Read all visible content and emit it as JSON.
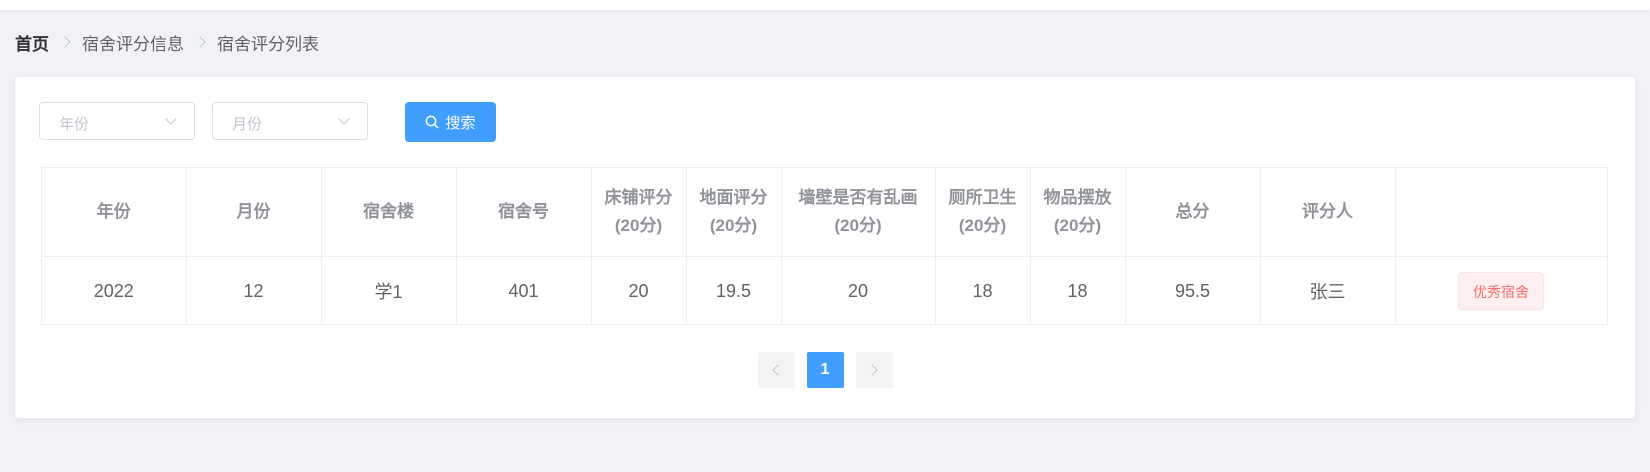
{
  "breadcrumb": {
    "home": "首页",
    "level1": "宿舍评分信息",
    "level2": "宿舍评分列表"
  },
  "filters": {
    "year_placeholder": "年份",
    "month_placeholder": "月份",
    "search_label": "搜索"
  },
  "table": {
    "headers": [
      "年份",
      "月份",
      "宿舍楼",
      "宿舍号",
      "床铺评分\n(20分)",
      "地面评分\n(20分)",
      "墙壁是否有乱画\n(20分)",
      "厕所卫生\n(20分)",
      "物品摆放\n(20分)",
      "总分",
      "评分人",
      ""
    ],
    "rows": [
      {
        "year": "2022",
        "month": "12",
        "building": "学1",
        "room": "401",
        "bed_score": "20",
        "floor_score": "19.5",
        "wall_score": "20",
        "toilet_score": "18",
        "items_score": "18",
        "total": "95.5",
        "rater": "张三",
        "tag": "优秀宿舍"
      }
    ]
  },
  "pagination": {
    "current_page": "1"
  },
  "colors": {
    "primary": "#409eff",
    "tag_danger_text": "#f56c6c",
    "tag_danger_bg": "#fef0f0",
    "page_bg": "#f0f2f5"
  },
  "icons": [
    "chevron-right-icon",
    "chevron-down-icon",
    "search-icon",
    "chevron-left-icon"
  ]
}
